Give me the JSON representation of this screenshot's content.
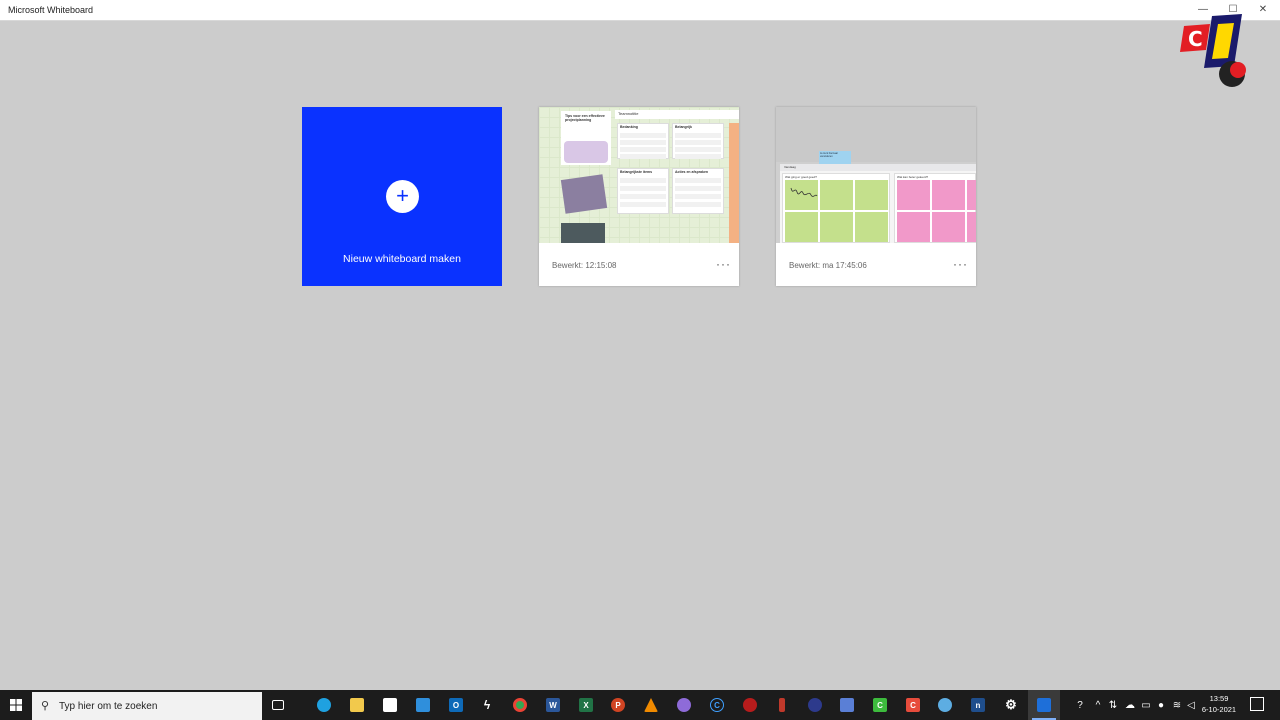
{
  "window": {
    "title": "Microsoft Whiteboard",
    "minimize": "—",
    "maximize": "☐",
    "close": "✕"
  },
  "new_board": {
    "plus": "+",
    "label": "Nieuw whiteboard maken"
  },
  "boards": [
    {
      "edited": "Bewerkt: 12:15:08",
      "more": "···",
      "thumb": {
        "paper_title": "Tips voor een effectieve projectplanning",
        "topbar": "Teamnotitie",
        "panels": [
          "Bedanking",
          "Belangrijk",
          "Belangrijkste items",
          "Acties en afspraken"
        ]
      }
    },
    {
      "edited": "Bewerkt: ma 17:45:06",
      "more": "···",
      "thumb": {
        "note": "Je kunt hiernaar veranderen",
        "header": "Vandaag",
        "sections": [
          "Wat ging er goed goed?",
          "Wat kan beter geleerd?"
        ]
      }
    }
  ],
  "taskbar": {
    "search_placeholder": "Typ hier om te zoeken",
    "apps": [
      "task-view",
      "edge",
      "file-explorer",
      "store",
      "mail",
      "outlook",
      "app-bolt",
      "chrome",
      "word",
      "excel",
      "powerpoint",
      "vlc",
      "app-purple",
      "app-c",
      "app-red",
      "app-tool",
      "app-globe",
      "app-device",
      "app-green",
      "app-red-square",
      "app-circle",
      "app-blue",
      "settings",
      "whiteboard"
    ],
    "active_app": "whiteboard",
    "time": "13:59",
    "date": "6-10-2021"
  },
  "colors": {
    "accent": "#0a32ff",
    "background": "#cccccc",
    "taskbar": "#1c1c1c"
  }
}
